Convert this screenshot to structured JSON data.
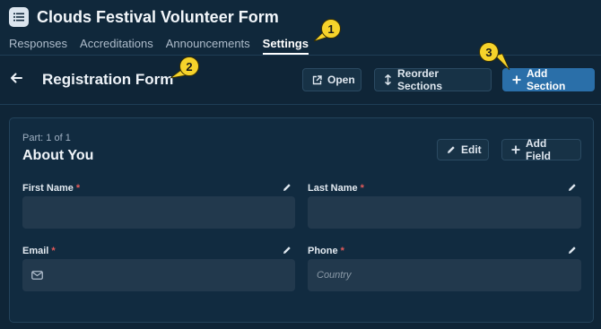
{
  "app": {
    "title": "Clouds Festival Volunteer Form",
    "icon": "list-icon"
  },
  "tabs": [
    {
      "label": "Responses",
      "active": false
    },
    {
      "label": "Accreditations",
      "active": false
    },
    {
      "label": "Announcements",
      "active": false
    },
    {
      "label": "Settings",
      "active": true
    }
  ],
  "header": {
    "title": "Registration Form",
    "open_label": "Open",
    "reorder_label": "Reorder Sections",
    "add_section_label": "Add Section"
  },
  "section": {
    "part": "Part: 1 of 1",
    "title": "About You",
    "edit_label": "Edit",
    "add_field_label": "Add Field"
  },
  "fields": {
    "first_name": {
      "label": "First Name",
      "required_mark": "*",
      "value": ""
    },
    "last_name": {
      "label": "Last Name",
      "required_mark": "*",
      "value": ""
    },
    "email": {
      "label": "Email",
      "required_mark": "*",
      "value": "",
      "icon": "mail-icon"
    },
    "phone": {
      "label": "Phone",
      "required_mark": "*",
      "placeholder": "Country"
    }
  },
  "annotations": [
    "1",
    "2",
    "3"
  ],
  "colors": {
    "background": "#0f2537",
    "primary_button": "#2a6fa9",
    "required": "#e35a5a",
    "badge": "#f6d32b"
  }
}
